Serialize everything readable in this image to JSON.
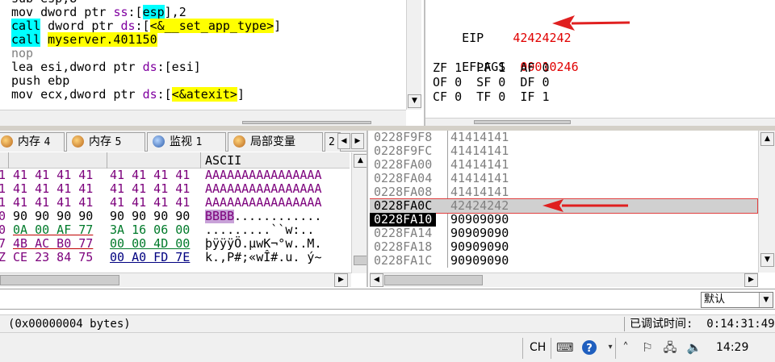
{
  "disasm": {
    "lines": [
      [
        {
          "t": "sub esp,8"
        }
      ],
      [
        {
          "t": "mov dword ptr "
        },
        {
          "t": "ss",
          "c": "seg"
        },
        {
          "t": ":["
        },
        {
          "t": "esp",
          "c": "cyanbox"
        },
        {
          "t": "],2"
        }
      ],
      [
        {
          "t": "call",
          "c": "cyanbox"
        },
        {
          "t": " dword ptr "
        },
        {
          "t": "ds",
          "c": "seg"
        },
        {
          "t": ":["
        },
        {
          "t": "<&__set_app_type>",
          "c": "ylw"
        },
        {
          "t": "]"
        }
      ],
      [
        {
          "t": "call",
          "c": "cyanbox"
        },
        {
          "t": " "
        },
        {
          "t": "myserver.401150",
          "c": "ylw"
        }
      ],
      [
        {
          "t": "nop",
          "c": "grey"
        }
      ],
      [
        {
          "t": "lea esi,dword ptr "
        },
        {
          "t": "ds",
          "c": "seg"
        },
        {
          "t": ":[esi]"
        }
      ],
      [
        {
          "t": "push ebp"
        }
      ],
      [
        {
          "t": "mov ecx,dword ptr "
        },
        {
          "t": "ds",
          "c": "seg"
        },
        {
          "t": ":["
        },
        {
          "t": "<&atexit>",
          "c": "ylw"
        },
        {
          "t": "]"
        }
      ]
    ]
  },
  "registers": {
    "eip_label": "EIP",
    "eip_value": "42424242",
    "eflags_label": "EFLAGS",
    "eflags_value": "00010246",
    "flags_row1": "ZF 1  PF 1  AF 0",
    "flags_row2": "OF 0  SF 0  DF 0",
    "flags_row3": "CF 0  TF 0  IF 1"
  },
  "tabs": {
    "items": [
      {
        "label": "内存",
        "num": "4"
      },
      {
        "label": "内存",
        "num": "5"
      },
      {
        "label": "监视",
        "num": "1"
      },
      {
        "label": "局部变量",
        "num": ""
      },
      {
        "label": "2",
        "num": ""
      }
    ]
  },
  "dump": {
    "ascii_header": "ASCII",
    "rows": [
      {
        "lead": "1",
        "b1": "41 41 41 41",
        "b2": "41 41 41 41",
        "ascii": "AAAAAAAAAAAAAAAA"
      },
      {
        "lead": "1",
        "b1": "41 41 41 41",
        "b2": "41 41 41 41",
        "ascii": "AAAAAAAAAAAAAAAA"
      },
      {
        "lead": "1",
        "b1": "41 41 41 41",
        "b2": "41 41 41 41",
        "ascii": "AAAAAAAAAAAAAAAA"
      },
      {
        "lead": "0",
        "b1": "90 90 90 90",
        "b2": "90 90 90 90",
        "ascii_hl": "BBBB",
        "ascii": "............"
      },
      {
        "lead": "0",
        "b1": "0A 00 AF 77",
        "b2": "3A 16 06 00",
        "ascii": ".........``w:.."
      },
      {
        "lead": "7",
        "b1": "4B AC B0 77",
        "b2": "00 00 4D 00",
        "ascii": "þÿÿÿÖ.µwK¬°w..M."
      },
      {
        "lead": "Z",
        "b1": "CE 23 84 75",
        "b2": "00 A0 FD 7E",
        "ascii": "k.,P#;«wÎ#.u. ý~"
      }
    ]
  },
  "stack": {
    "rows": [
      {
        "addr": "0228F9F8",
        "val": "41414141",
        "state": "grey"
      },
      {
        "addr": "0228F9FC",
        "val": "41414141",
        "state": "grey"
      },
      {
        "addr": "0228FA00",
        "val": "41414141",
        "state": "grey"
      },
      {
        "addr": "0228FA04",
        "val": "41414141",
        "state": "grey"
      },
      {
        "addr": "0228FA08",
        "val": "41414141",
        "state": "grey"
      },
      {
        "addr": "0228FA0C",
        "val": "42424242",
        "state": "highlight"
      },
      {
        "addr": "0228FA10",
        "val": "90909090",
        "state": "selected"
      },
      {
        "addr": "0228FA14",
        "val": "90909090",
        "state": "grey"
      },
      {
        "addr": "0228FA18",
        "val": "90909090",
        "state": "grey"
      },
      {
        "addr": "0228FA1C",
        "val": "90909090",
        "state": "grey"
      }
    ]
  },
  "command": {
    "combo_value": "默认"
  },
  "status": {
    "left": "(0x00000004 bytes)",
    "right_label": "已调试时间:",
    "right_value": "0:14:31:49"
  },
  "tray": {
    "ime": "CH",
    "clock": "14:29"
  },
  "colors": {
    "accent_red": "#e00000",
    "highlight_yellow": "#ffff00",
    "highlight_cyan": "#00ffff"
  }
}
